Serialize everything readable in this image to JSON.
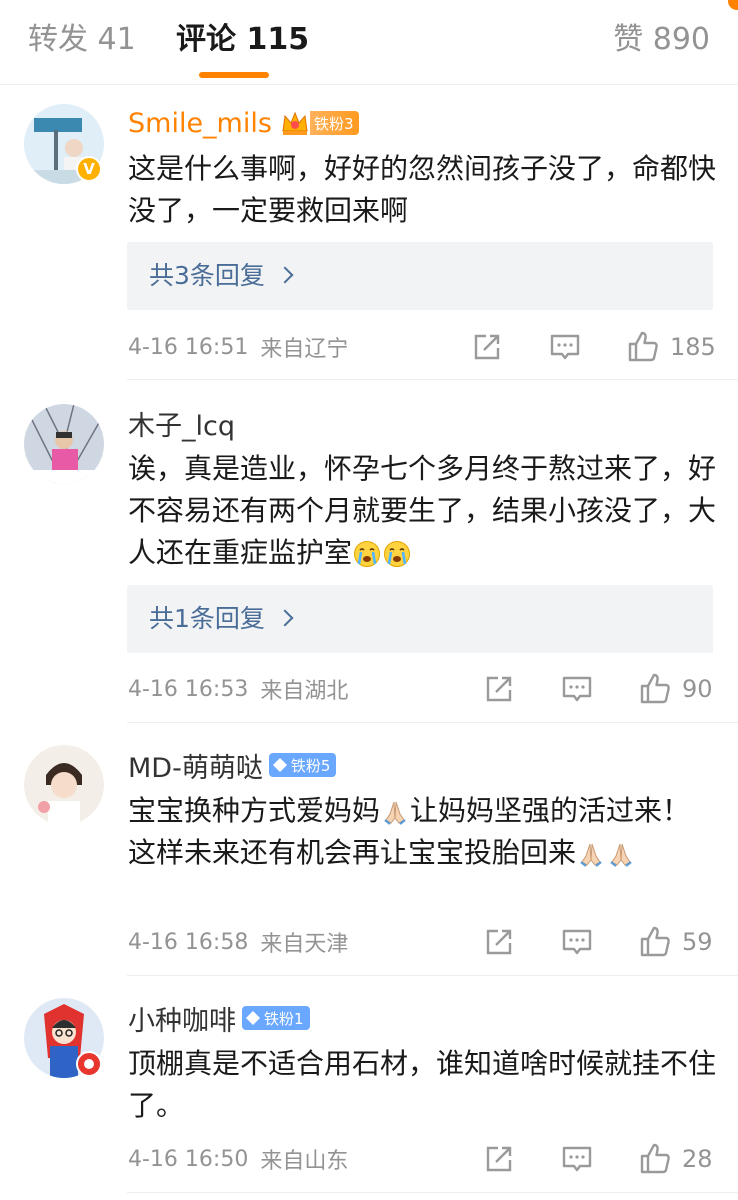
{
  "tabs": {
    "repost_label": "转发 41",
    "comment_label": "评论 115",
    "like_label": "赞 890"
  },
  "colors": {
    "accent": "#ff8200",
    "link": "#4a6d98",
    "meta": "#939393"
  },
  "comments": [
    {
      "username": "Smile_mils",
      "fan_badge": "铁粉3",
      "text": "这是什么事啊，好好的忽然间孩子没了，命都快没了，一定要救回来啊",
      "reply_link": "共3条回复",
      "time": "4-16 16:51",
      "source": "来自辽宁",
      "likes": "185"
    },
    {
      "username": "木子_lcq",
      "text": "诶，真是造业，怀孕七个多月终于熬过来了，好不容易还有两个月就要生了，结果小孩没了，大人还在重症监护室",
      "reply_link": "共1条回复",
      "time": "4-16 16:53",
      "source": "来自湖北",
      "likes": "90"
    },
    {
      "username": "MD-萌萌哒",
      "fan_badge": "铁粉5",
      "text_a": "宝宝换种方式爱妈妈",
      "text_b": "让妈妈坚强的活过来！这样未来还有机会再让宝宝投胎回来",
      "time": "4-16 16:58",
      "source": "来自天津",
      "likes": "59"
    },
    {
      "username": "小种咖啡",
      "fan_badge": "铁粉1",
      "text": "顶棚真是不适合用石材，谁知道啥时候就挂不住了。",
      "time": "4-16 16:50",
      "source": "来自山东",
      "likes": "28"
    }
  ],
  "icons": {
    "repost": "share-icon",
    "comment": "comment-icon",
    "like": "thumbs-up-icon",
    "cry_emoji": "crying-face-emoji",
    "pray_emoji": "praying-hands-emoji"
  }
}
